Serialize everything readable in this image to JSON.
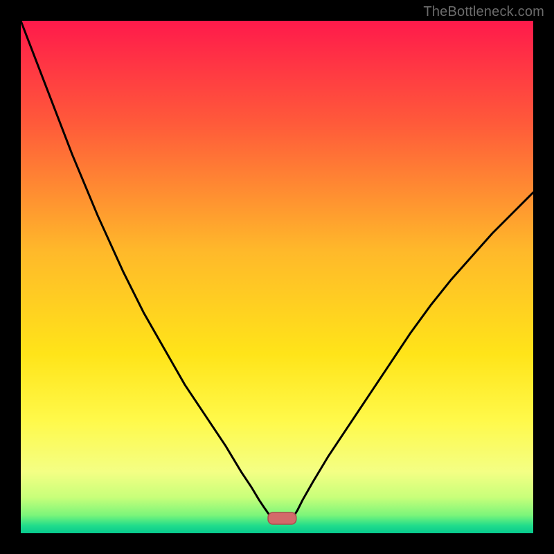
{
  "watermark": "TheBottleneck.com",
  "chart_data": {
    "type": "line",
    "title": "",
    "xlabel": "",
    "ylabel": "",
    "xlim": [
      0,
      100
    ],
    "ylim": [
      0,
      100
    ],
    "gradient_stops": [
      {
        "offset": 0.0,
        "color": "#ff1a4b"
      },
      {
        "offset": 0.2,
        "color": "#ff5a3a"
      },
      {
        "offset": 0.45,
        "color": "#ffb92a"
      },
      {
        "offset": 0.65,
        "color": "#ffe419"
      },
      {
        "offset": 0.78,
        "color": "#fff94a"
      },
      {
        "offset": 0.88,
        "color": "#f4ff84"
      },
      {
        "offset": 0.93,
        "color": "#c8ff7a"
      },
      {
        "offset": 0.965,
        "color": "#7bf57a"
      },
      {
        "offset": 0.985,
        "color": "#21dd8b"
      },
      {
        "offset": 1.0,
        "color": "#06c98e"
      }
    ],
    "series": [
      {
        "name": "bottleneck-curve-left",
        "x": [
          0,
          5,
          10,
          15,
          20,
          24,
          28,
          32,
          36,
          40,
          43,
          45,
          46.5,
          47.5,
          48.2,
          48.8
        ],
        "values": [
          100,
          87,
          74,
          62,
          51,
          43,
          36,
          29,
          23,
          17,
          12,
          9,
          6.5,
          5,
          4,
          3.2
        ]
      },
      {
        "name": "bottleneck-curve-right",
        "x": [
          53.2,
          54,
          55,
          57,
          60,
          64,
          68,
          72,
          76,
          80,
          84,
          88,
          92,
          96,
          100
        ],
        "values": [
          3.2,
          4.5,
          6.5,
          10,
          15,
          21,
          27,
          33,
          39,
          44.5,
          49.5,
          54,
          58.5,
          62.5,
          66.5
        ]
      }
    ],
    "optimal_marker": {
      "x_center": 51,
      "y": 2.9,
      "width": 5.5,
      "height": 2.3,
      "fill": "#d36a6a",
      "stroke": "#a94d4d"
    }
  }
}
